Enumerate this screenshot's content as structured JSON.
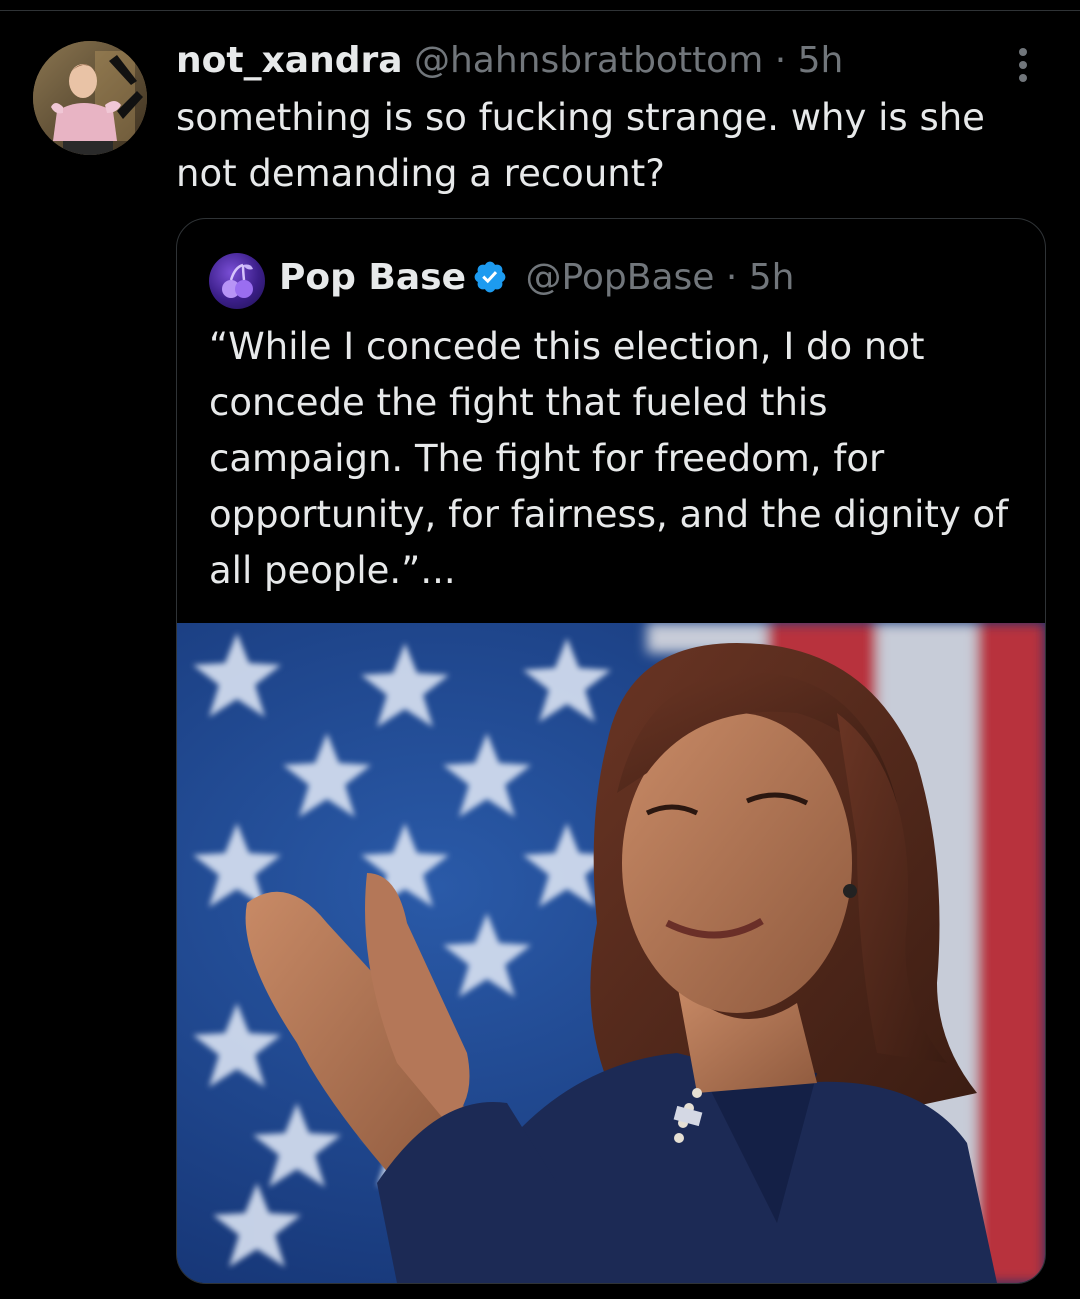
{
  "tweet": {
    "display_name": "not_xandra",
    "handle": "@hahnsbratbottom",
    "separator": "·",
    "time": "5h",
    "text": "something is so fucking strange. why is she not demanding a recount?",
    "more_icon": "more-vertical-icon"
  },
  "quote": {
    "display_name": "Pop Base",
    "verified_icon": "verified-badge-icon",
    "handle": "@PopBase",
    "separator": "·",
    "time": "5h",
    "text": "“While I concede this election, I do not concede the fight that fueled this campaign. The fight for freedom, for opportunity, for fairness, and the dignity of all people.”...",
    "media_icon": "photo",
    "colors": {
      "verified": "#1d9bf0",
      "flag_blue": "#1b3f86",
      "flag_red": "#b8313c"
    }
  },
  "theme": {
    "background": "#000000",
    "primary_text": "#e7e9ea",
    "secondary_text": "#71767b",
    "border": "#2f3336"
  }
}
